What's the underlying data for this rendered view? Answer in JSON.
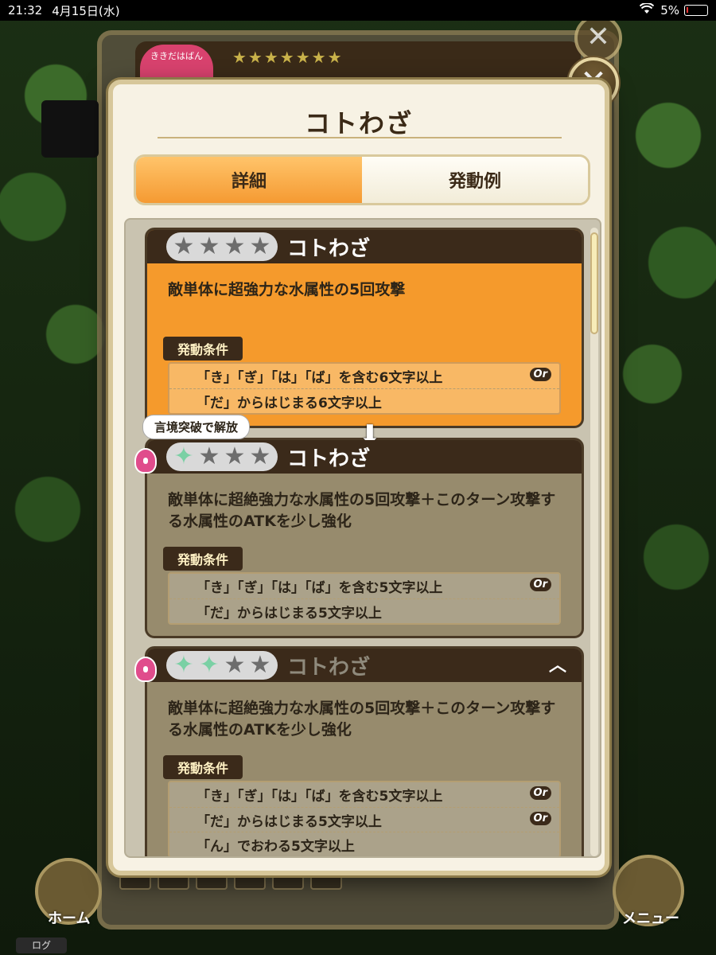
{
  "status_bar": {
    "time": "21:32",
    "date": "4月15日(水)",
    "battery": "5%"
  },
  "background": {
    "badge_text": "ききだはばん",
    "home_label": "ホーム",
    "menu_label": "メニュー",
    "log_label": "ログ"
  },
  "dialog": {
    "title": "コトわざ",
    "close_icon": "close-icon",
    "tabs": [
      {
        "label": "詳細",
        "active": true
      },
      {
        "label": "発動例",
        "active": false
      }
    ]
  },
  "cards": [
    {
      "name": "コトわざ",
      "state": "active",
      "stars": {
        "rainbow": 0,
        "gray": 4
      },
      "description": "敵単体に超強力な水属性の5回攻撃",
      "condition_label": "発動条件",
      "conditions": [
        {
          "text": "「き」「ぎ」「は」「ば」を含む6文字以上",
          "or": "Or"
        },
        {
          "text": "「だ」からはじまる6文字以上",
          "or": ""
        }
      ]
    },
    {
      "name": "コトわざ",
      "state": "locked",
      "unlock_tag": "言境突破で解放",
      "stars": {
        "rainbow": 1,
        "gray": 3
      },
      "description": "敵単体に超絶強力な水属性の5回攻撃＋このターン攻撃する水属性のATKを少し強化",
      "condition_label": "発動条件",
      "conditions": [
        {
          "text": "「き」「ぎ」「は」「ば」を含む5文字以上",
          "or": "Or"
        },
        {
          "text": "「だ」からはじまる5文字以上",
          "or": ""
        }
      ]
    },
    {
      "name": "コトわざ",
      "state": "locked",
      "stars": {
        "rainbow": 2,
        "gray": 2
      },
      "description": "敵単体に超絶強力な水属性の5回攻撃＋このターン攻撃する水属性のATKを少し強化",
      "condition_label": "発動条件",
      "conditions": [
        {
          "text": "「き」「ぎ」「は」「ば」を含む5文字以上",
          "or": "Or"
        },
        {
          "text": "「だ」からはじまる5文字以上",
          "or": "Or"
        },
        {
          "text": "「ん」でおわる5文字以上",
          "or": ""
        }
      ]
    }
  ],
  "colors": {
    "active_card": "#f59a2c",
    "locked_card": "#978b6d",
    "header_dark": "#3b2a1a",
    "lock_pink": "#e04c8c"
  }
}
